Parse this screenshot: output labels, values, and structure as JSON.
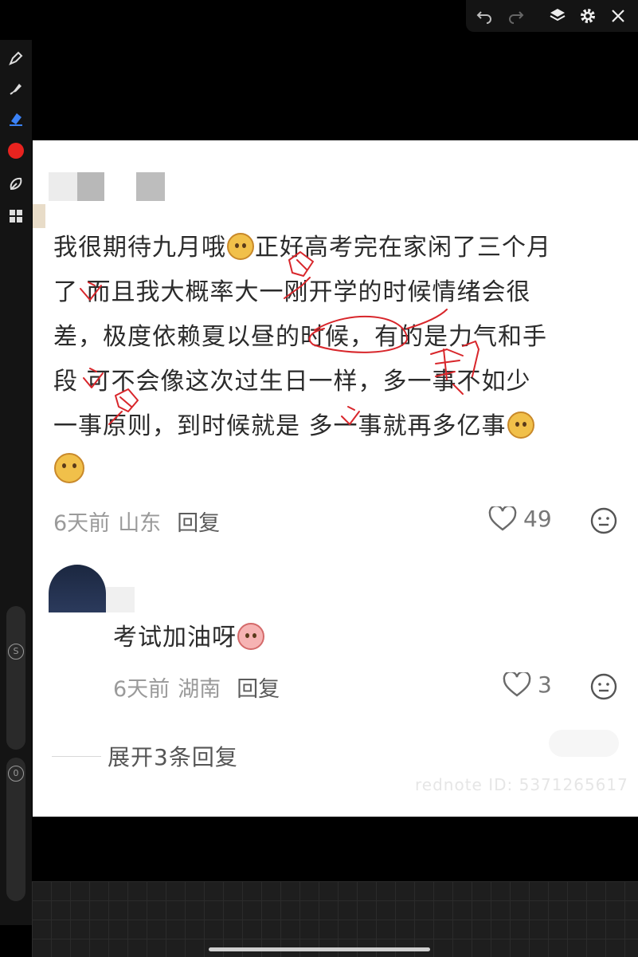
{
  "toolbar_top": {
    "icons": [
      "undo-icon",
      "redo-icon",
      "layers-icon",
      "gear-icon",
      "close-icon"
    ]
  },
  "toolbar_left": {
    "icons": [
      "pen-icon",
      "marker-icon",
      "eraser-icon",
      "color-red-icon",
      "lasso-icon",
      "grid-icon"
    ],
    "active_color": "#e8231f",
    "size_slider_label": "S",
    "opacity_slider_label": "0"
  },
  "comment": {
    "text_lines": [
      "我很期待九月哦",
      "正好高考完在家闲了三个月",
      "了",
      " 而且我大概率大一刚开学的时候情绪会很",
      "差，极度依赖夏以昼的时候，有的是力气和手",
      "段",
      " 可不会像这次过生日一样，多一事不如少",
      "一事原则，到时候就是",
      " 多一事就再多亿事"
    ],
    "time": "6天前",
    "location": "山东",
    "reply_label": "回复",
    "like_count": "49"
  },
  "reply": {
    "text": "考试加油呀",
    "time": "6天前",
    "location": "湖南",
    "reply_label": "回复",
    "like_count": "3"
  },
  "expand_replies": "展开3条回复",
  "watermark": "rednote ID: 5371265617",
  "annotation_color": "#d8262b"
}
